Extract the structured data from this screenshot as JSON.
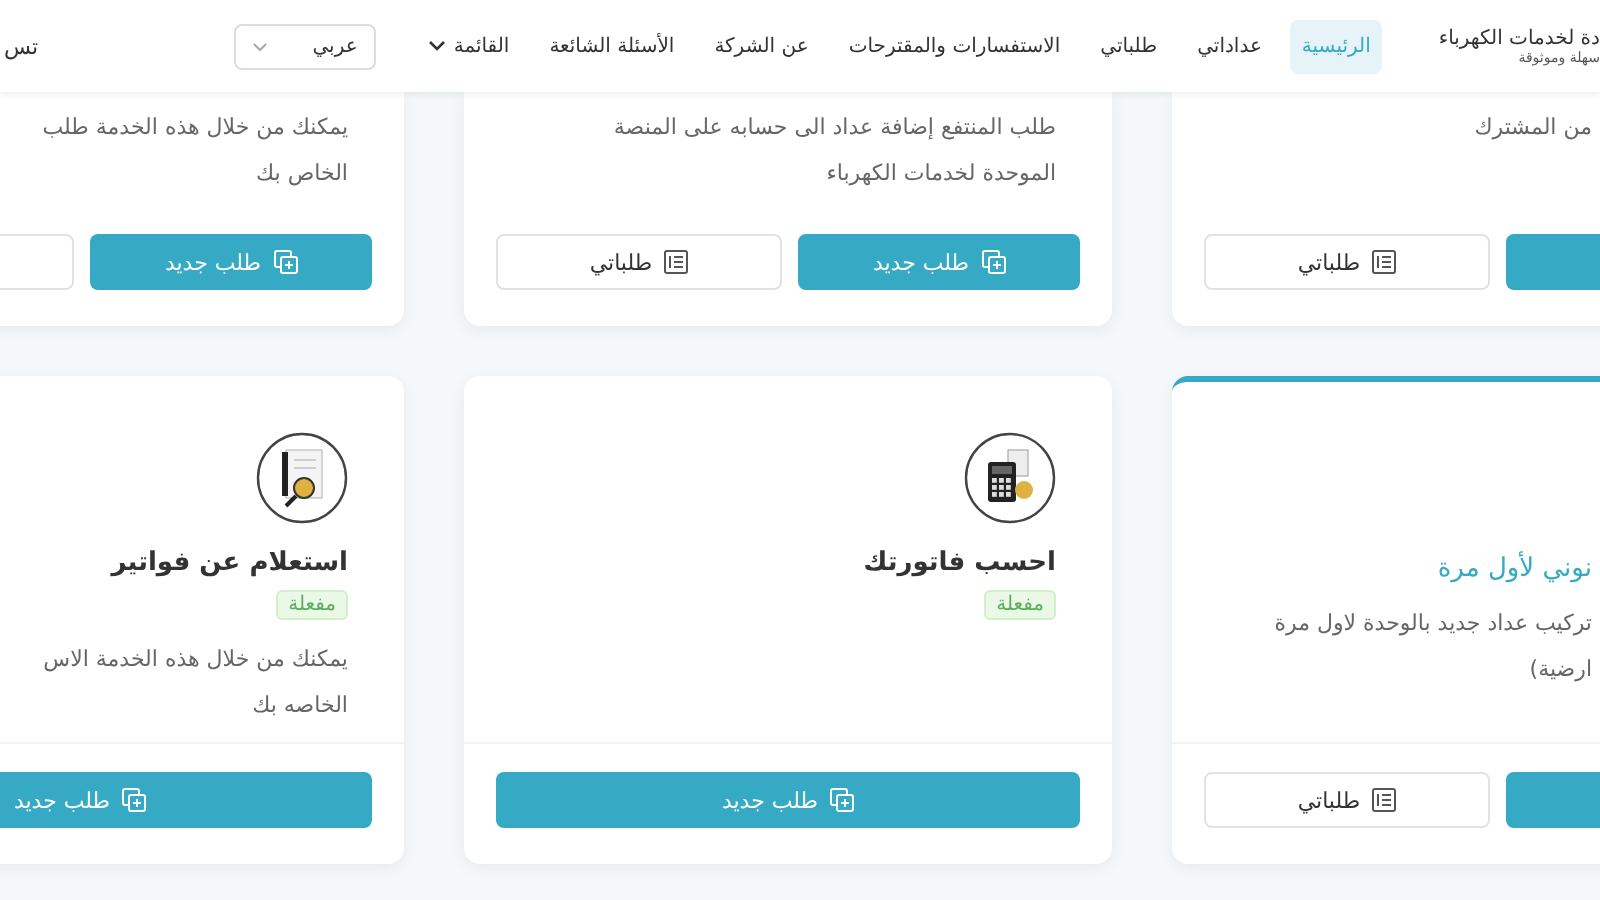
{
  "header": {
    "brand": [
      "دة لخدمات الكهرباء",
      "سهلة وموثوقة"
    ],
    "nav": [
      {
        "label": "الرئيسية",
        "selected": true,
        "kind": "link"
      },
      {
        "label": "عداداتي",
        "selected": false,
        "kind": "link"
      },
      {
        "label": "طلباتي",
        "selected": false,
        "kind": "link"
      },
      {
        "label": "الاستفسارات والمقترحات",
        "selected": false,
        "kind": "link"
      },
      {
        "label": "عن الشركة",
        "selected": false,
        "kind": "link"
      },
      {
        "label": "الأسئلة الشائعة",
        "selected": false,
        "kind": "link"
      },
      {
        "label": "القائمة",
        "selected": false,
        "kind": "dropdown"
      }
    ],
    "language": {
      "value": "عربي"
    },
    "login": "تس"
  },
  "rows": [
    {
      "cards": [
        {
          "highlighted": false,
          "lines": [
            "من المشترك"
          ],
          "buttons": [
            {
              "kind": "primary"
            },
            {
              "kind": "outline",
              "label": "طلباتي"
            }
          ]
        },
        {
          "highlighted": false,
          "lines": [
            "طلب المنتفع إضافة عداد الى حسابه على المنصة",
            "الموحدة لخدمات الكهرباء"
          ],
          "buttons": [
            {
              "kind": "primary",
              "label": "طلب جديد"
            },
            {
              "kind": "outline",
              "label": "طلباتي"
            }
          ]
        },
        {
          "highlighted": false,
          "lines": [
            "يمكنك من خلال هذه الخدمة طلب",
            "الخاص بك"
          ],
          "buttons": [
            {
              "kind": "primary",
              "label": "طلب جديد"
            },
            {
              "kind": "outline"
            }
          ]
        }
      ]
    },
    {
      "cards": [
        {
          "highlighted": true,
          "title": "نوني لأول مرة",
          "lines": [
            "تركيب عداد جديد بالوحدة لاول مرة",
            "ارضية)"
          ],
          "buttons": [
            {
              "kind": "primary"
            },
            {
              "kind": "outline",
              "label": "طلباتي"
            }
          ]
        },
        {
          "highlighted": false,
          "kind": "calculator",
          "title": "احسب فاتورتك",
          "status": "مفعلة",
          "buttons": [
            {
              "kind": "primary",
              "label": "طلب جديد"
            }
          ]
        },
        {
          "highlighted": false,
          "kind": "invoice",
          "title": "استعلام عن فواتير",
          "status": "مفعلة",
          "lines": [
            "يمكنك من خلال هذه الخدمة الاس",
            "الخاصه بك"
          ],
          "buttons": [
            {
              "kind": "primary",
              "label": "طلب جديد"
            }
          ]
        }
      ]
    }
  ]
}
